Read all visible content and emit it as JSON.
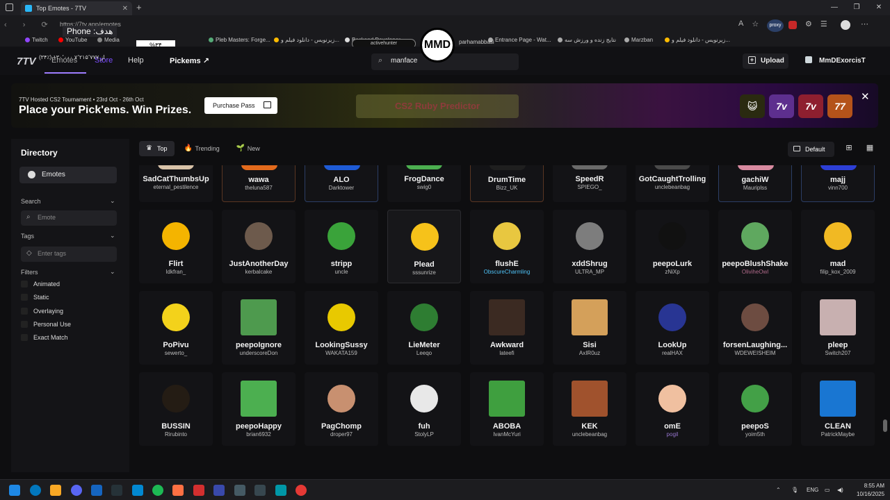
{
  "browser": {
    "tab_title": "Top Emotes - 7TV",
    "url": "https://7tv.app/emotes",
    "bookmarks": [
      "Twitch",
      "YouTube",
      "Media",
      "Twitch Chat Picker...",
      "Pleb Masters: Forge...",
      "زیرنویس - دانلود فیلم و...",
      "Backend Developer...",
      "Online...",
      "Entrance Page - Wat...",
      "نتایج زنده و ورزش سه",
      "Marzban",
      "زیرنویس - دانلود فیلم و..."
    ],
    "proxy_label": "proxy"
  },
  "overlays": {
    "phone": "Phone :هدف",
    "percent": "%۳۴",
    "fa_text": "(۳۴٪) ۱۳۰٬۰۰۰ از ۷٬۲۱۵٬۷۷۷",
    "logo": "MMD",
    "pill": "activehunter",
    "right_text": "parhamabbasi"
  },
  "header": {
    "brand": "7TV",
    "nav": {
      "emotes": "Emotes",
      "store": "Store",
      "help": "Help",
      "pickems": "Pickems ↗"
    },
    "search_value": "manface",
    "upload_label": "Upload",
    "username": "MmDExorcisT"
  },
  "banner": {
    "subtitle": "7TV Hosted CS2 Tournament • 23rd Oct - 26th Oct",
    "title": "Place your Pick'ems. Win Prizes.",
    "purchase_label": "Purchase Pass",
    "predictor_label": "CS2 Ruby Predictor",
    "icons": [
      "😺",
      "7v",
      "7v",
      "77"
    ]
  },
  "sidebar": {
    "title": "Directory",
    "emotes_label": "Emotes",
    "search_label": "Search",
    "search_placeholder": "Emote",
    "tags_label": "Tags",
    "tags_placeholder": "Enter tags",
    "filters_label": "Filters",
    "filters": [
      "Animated",
      "Static",
      "Overlaying",
      "Personal Use",
      "Exact Match"
    ]
  },
  "main": {
    "tabs": [
      {
        "label": "Top",
        "icon": "♛"
      },
      {
        "label": "Trending",
        "icon": "🔥"
      },
      {
        "label": "New",
        "icon": "🌱"
      }
    ],
    "sort_label": "Default",
    "rows": [
      [
        {
          "name": "SadCatThumbsUp",
          "owner": "eternal_pestilence"
        },
        {
          "name": "wawa",
          "owner": "theluna587",
          "border": "orange"
        },
        {
          "name": "ALO",
          "owner": "Darktower",
          "border": "blue"
        },
        {
          "name": "FrogDance",
          "owner": "swig0"
        },
        {
          "name": "DrumTime",
          "owner": "Bizz_UK",
          "border": "orange"
        },
        {
          "name": "SpeedR",
          "owner": "SPIEGO_"
        },
        {
          "name": "GotCaughtTrolling",
          "owner": "unclebeanbag"
        },
        {
          "name": "gachiW",
          "owner": "Mauriplss",
          "border": "blue"
        },
        {
          "name": "majj",
          "owner": "vinn700",
          "border": "blue"
        }
      ],
      [
        {
          "name": "Flirt",
          "owner": "ldkfran_"
        },
        {
          "name": "JustAnotherDay",
          "owner": "kerbalcake"
        },
        {
          "name": "stripp",
          "owner": "uncle"
        },
        {
          "name": "Plead",
          "owner": "sssunrize",
          "border": "hover"
        },
        {
          "name": "flushE",
          "owner": "ObscureCharmling",
          "owner_style": "cyan"
        },
        {
          "name": "xddShrug",
          "owner": "ULTRA_MP"
        },
        {
          "name": "peepoLurk",
          "owner": "zNiXp"
        },
        {
          "name": "peepoBlushShake",
          "owner": "OliviheOwl",
          "owner_style": "pink"
        },
        {
          "name": "mad",
          "owner": "filip_kox_2009"
        }
      ],
      [
        {
          "name": "PoPivu",
          "owner": "sewerto_"
        },
        {
          "name": "peepoIgnore",
          "owner": "underscoreDon"
        },
        {
          "name": "LookingSussy",
          "owner": "WAKATA159"
        },
        {
          "name": "LieMeter",
          "owner": "Leeqo"
        },
        {
          "name": "Awkward",
          "owner": "lateefi"
        },
        {
          "name": "Sisi",
          "owner": "AxIR0uz"
        },
        {
          "name": "LookUp",
          "owner": "realHAX"
        },
        {
          "name": "forsenLaughing...",
          "owner": "WDEWEISHEIM"
        },
        {
          "name": "pleep",
          "owner": "Switch207"
        }
      ],
      [
        {
          "name": "BUSSIN",
          "owner": "Rirubinto"
        },
        {
          "name": "peepoHappy",
          "owner": "brian6932"
        },
        {
          "name": "PagChomp",
          "owner": "droper97"
        },
        {
          "name": "fuh",
          "owner": "StolyLP"
        },
        {
          "name": "ABOBA",
          "owner": "IvanMcYuri"
        },
        {
          "name": "KEK",
          "owner": "unclebeanbag"
        },
        {
          "name": "omE",
          "owner": "pogil",
          "owner_style": "purple"
        },
        {
          "name": "peepoS",
          "owner": "yoim5th"
        },
        {
          "name": "CLEAN",
          "owner": "PatrickMaybe"
        }
      ]
    ]
  },
  "taskbar": {
    "lang": "ENG",
    "time": "8:55 AM",
    "date": "10/16/2025"
  }
}
